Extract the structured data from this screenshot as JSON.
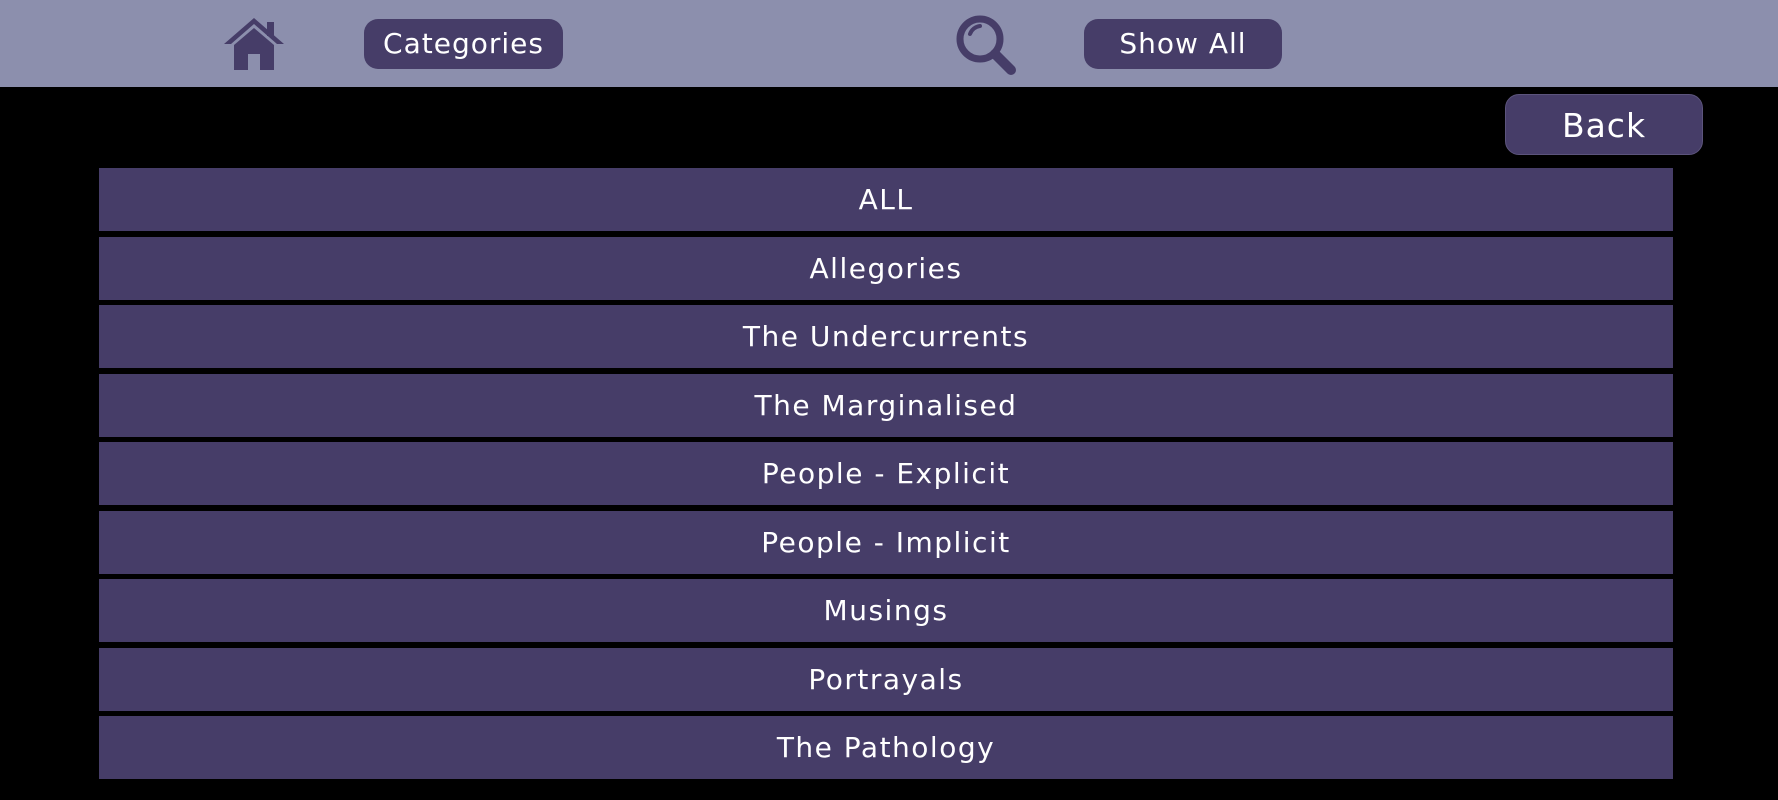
{
  "toolbar": {
    "home_icon": "home-icon",
    "categories_label": "Categories",
    "search_icon": "search-icon",
    "show_all_label": "Show All"
  },
  "back_label": "Back",
  "categories": [
    {
      "label": "ALL"
    },
    {
      "label": "Allegories"
    },
    {
      "label": "The Undercurrents"
    },
    {
      "label": "The Marginalised"
    },
    {
      "label": "People - Explicit"
    },
    {
      "label": "People - Implicit"
    },
    {
      "label": "Musings"
    },
    {
      "label": "Portrayals"
    },
    {
      "label": "The Pathology"
    }
  ],
  "colors": {
    "toolbar_bg": "#8c8fad",
    "button_bg": "#463d68",
    "page_bg": "#000000",
    "text": "#ffffff"
  }
}
